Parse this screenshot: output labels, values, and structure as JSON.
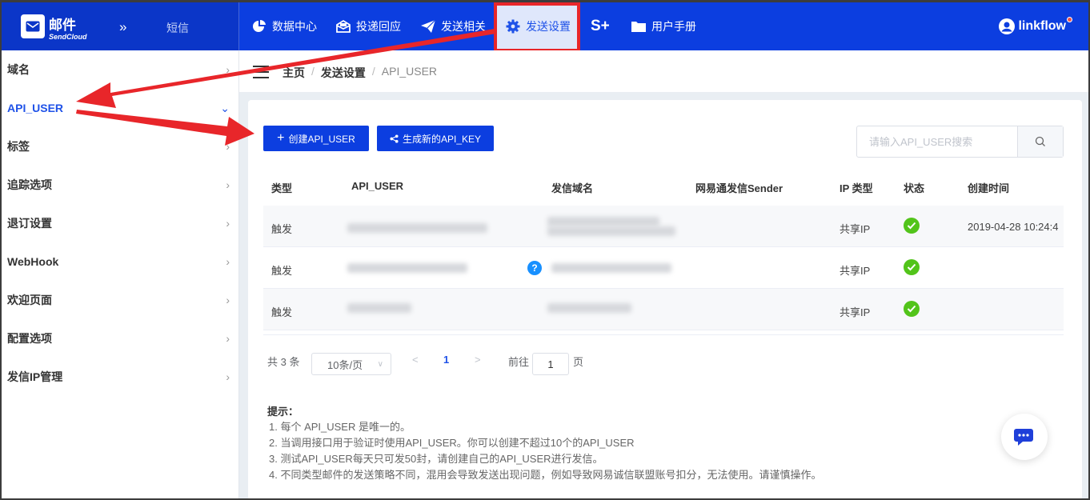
{
  "brand": {
    "title": "邮件",
    "subtitle": "SendCloud",
    "sms": "短信"
  },
  "nav": [
    {
      "label": "数据中心",
      "icon": "pie-chart-icon"
    },
    {
      "label": "投递回应",
      "icon": "envelope-open-icon"
    },
    {
      "label": "发送相关",
      "icon": "paper-plane-icon"
    },
    {
      "label": "发送设置",
      "icon": "gear-icon"
    },
    {
      "label": "S+",
      "icon": "s-plus-icon"
    },
    {
      "label": "用户手册",
      "icon": "folder-icon"
    }
  ],
  "user": {
    "name": "linkflow"
  },
  "sidebar": {
    "items": [
      {
        "label": "域名"
      },
      {
        "label": "API_USER"
      },
      {
        "label": "标签"
      },
      {
        "label": "追踪选项"
      },
      {
        "label": "退订设置"
      },
      {
        "label": "WebHook"
      },
      {
        "label": "欢迎页面"
      },
      {
        "label": "配置选项"
      },
      {
        "label": "发信IP管理"
      }
    ]
  },
  "breadcrumb": {
    "home": "主页",
    "section": "发送设置",
    "current": "API_USER"
  },
  "toolbar": {
    "create_label": "创建API_USER",
    "generate_label": "生成新的API_KEY",
    "search_placeholder": "请输入API_USER搜索"
  },
  "table": {
    "headers": [
      "类型",
      "API_USER",
      "发信域名",
      "网易通发信Sender",
      "IP 类型",
      "状态",
      "创建时间"
    ],
    "rows": [
      {
        "type": "触发",
        "ip_type": "共享IP",
        "created": "2019-04-28 10:24:4"
      },
      {
        "type": "触发",
        "ip_type": "共享IP",
        "created": ""
      },
      {
        "type": "触发",
        "ip_type": "共享IP",
        "created": ""
      }
    ]
  },
  "pagination": {
    "total": "共 3 条",
    "page_size": "10条/页",
    "current_page": "1",
    "goto_prefix": "前往",
    "goto_value": "1",
    "goto_suffix": "页"
  },
  "tips": {
    "title": "提示：",
    "items": [
      "1. 每个 API_USER 是唯一的。",
      "2. 当调用接口用于验证时使用API_USER。你可以创建不超过10个的API_USER",
      "3. 测试API_USER每天只可发50封，请创建自己的API_USER进行发信。",
      "4. 不同类型邮件的发送策略不同，混用会导致发送出现问题，例如导致网易诚信联盟账号扣分，无法使用。请谨慎操作。"
    ]
  },
  "colors": {
    "primary": "#0c3ee0",
    "annotation": "#e8262a",
    "success": "#52c41a"
  }
}
